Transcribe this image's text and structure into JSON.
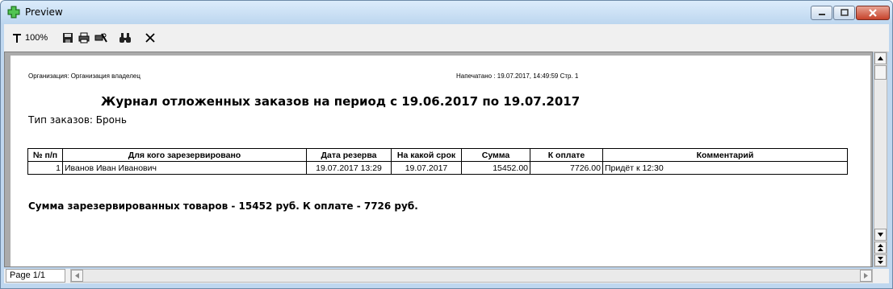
{
  "window": {
    "title": "Preview"
  },
  "toolbar": {
    "zoom_label": "100%"
  },
  "report": {
    "organization": "Организация: Организация владелец",
    "printed": "Напечатано : 19.07.2017, 14:49:59 Стр. 1",
    "title": "Журнал отложенных заказов на период с 19.06.2017 по 19.07.2017",
    "order_type": "Тип заказов: Бронь",
    "columns": [
      "№ п/п",
      "Для кого зарезервировано",
      "Дата резерва",
      "На какой срок",
      "Сумма",
      "К оплате",
      "Комментарий"
    ],
    "rows": [
      [
        "1",
        "Иванов Иван Иванович",
        "19.07.2017 13:29",
        "19.07.2017",
        "15452.00",
        "7726.00",
        "Придёт к 12:30"
      ]
    ],
    "summary": "Сумма зарезервированных товаров - 15452 руб. К оплате - 7726 руб."
  },
  "status": {
    "page_indicator": "Page 1/1"
  }
}
